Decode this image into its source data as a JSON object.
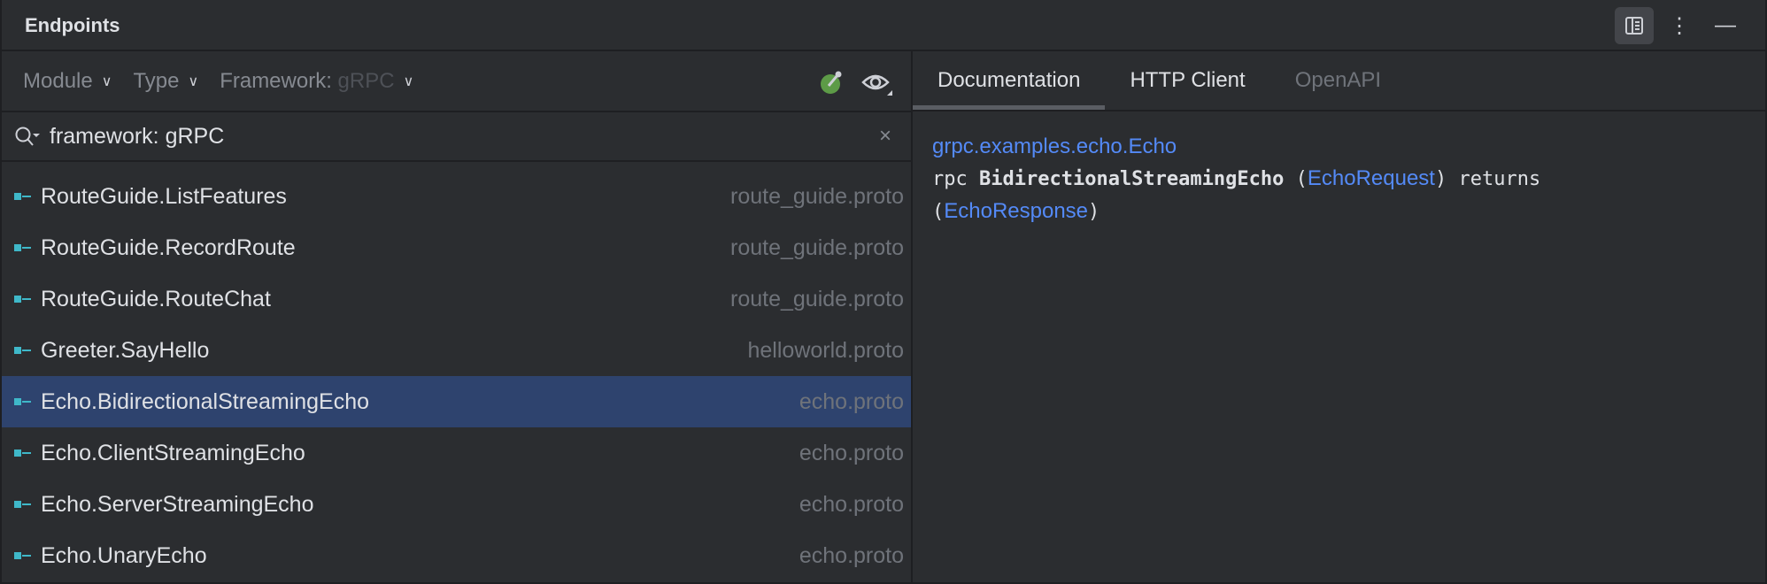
{
  "header": {
    "title": "Endpoints"
  },
  "filters": {
    "module": "Module",
    "type": "Type",
    "framework_label": "Framework:",
    "framework_value": "gRPC"
  },
  "search": {
    "value": "framework: gRPC"
  },
  "endpoints": [
    {
      "name": "RouteGuide.ListFeatures",
      "file": "route_guide.proto"
    },
    {
      "name": "RouteGuide.RecordRoute",
      "file": "route_guide.proto"
    },
    {
      "name": "RouteGuide.RouteChat",
      "file": "route_guide.proto"
    },
    {
      "name": "Greeter.SayHello",
      "file": "helloworld.proto"
    },
    {
      "name": "Echo.BidirectionalStreamingEcho",
      "file": "echo.proto",
      "selected": true
    },
    {
      "name": "Echo.ClientStreamingEcho",
      "file": "echo.proto"
    },
    {
      "name": "Echo.ServerStreamingEcho",
      "file": "echo.proto"
    },
    {
      "name": "Echo.UnaryEcho",
      "file": "echo.proto"
    }
  ],
  "tabs": [
    "Documentation",
    "HTTP Client",
    "OpenAPI"
  ],
  "doc": {
    "service": "grpc.examples.echo.Echo",
    "rpc_kw": "rpc",
    "method": "BidirectionalStreamingEcho",
    "open1": "(",
    "request": "EchoRequest",
    "close1": ")",
    "returns": "returns",
    "open2": "(",
    "response": "EchoResponse",
    "close2": ")"
  }
}
